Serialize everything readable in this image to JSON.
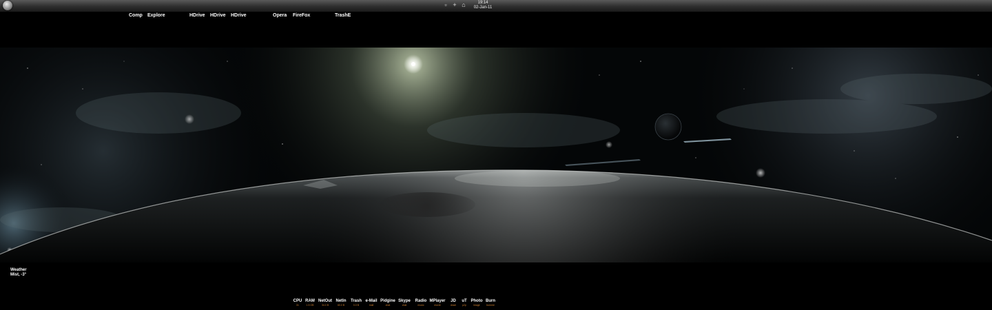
{
  "taskbar": {
    "clock_time": "19:14",
    "clock_date": "02-Jan-11",
    "tray_icons": [
      "media-icon",
      "plus-icon",
      "monitor-icon"
    ],
    "tray_glyphs": [
      "▫",
      "+",
      "⌂"
    ]
  },
  "launchers": [
    {
      "name": "launcher-comp",
      "label": "Comp"
    },
    {
      "name": "launcher-explore",
      "label": "Explore"
    },
    {
      "name": "launcher-hdrive-1",
      "label": "HDrive"
    },
    {
      "name": "launcher-hdrive-2",
      "label": "HDrive"
    },
    {
      "name": "launcher-hdrive-3",
      "label": "HDrive"
    },
    {
      "name": "launcher-opera",
      "label": "Opera"
    },
    {
      "name": "launcher-firefox",
      "label": "FireFox"
    },
    {
      "name": "launcher-trash",
      "label": "TrashE"
    }
  ],
  "weather": {
    "title": "Weather",
    "condition": "Mist, -3°"
  },
  "dock": [
    {
      "label": "CPU",
      "sub": "31"
    },
    {
      "label": "RAM",
      "sub": "1.5 GB"
    },
    {
      "label": "NetOut",
      "sub": "34.0 B"
    },
    {
      "label": "NetIn",
      "sub": "60.0 B"
    },
    {
      "label": "Trash",
      "sub": "0.0 B"
    },
    {
      "label": "e-Mail",
      "sub": "mail"
    },
    {
      "label": "Pidgine",
      "sub": "chat"
    },
    {
      "label": "Skype",
      "sub": "chat"
    },
    {
      "label": "Radio",
      "sub": "music"
    },
    {
      "label": "MPlayer",
      "sub": "movie"
    },
    {
      "label": "JD",
      "sub": "down"
    },
    {
      "label": "uT",
      "sub": "p2p"
    },
    {
      "label": "Photo",
      "sub": "image"
    },
    {
      "label": "Burn",
      "sub": "burnme"
    }
  ],
  "colors": {
    "taskbar": "#3a3a3a",
    "background": "#000000",
    "dock_sub": "#d08030"
  }
}
